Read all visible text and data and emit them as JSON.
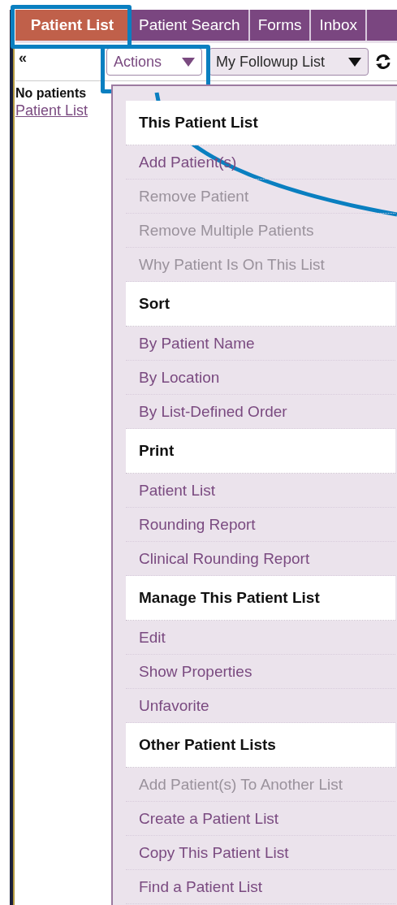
{
  "tabs": [
    {
      "label": "Patient List",
      "selected": true
    },
    {
      "label": "Patient Search",
      "selected": false
    },
    {
      "label": "Forms",
      "selected": false
    },
    {
      "label": "Inbox",
      "selected": false
    }
  ],
  "toolbar": {
    "collapse": "«",
    "actions": "Actions",
    "list_select": "My Followup List"
  },
  "sidebar": {
    "message": "No patients",
    "link": "Patient List"
  },
  "menu": {
    "sections": [
      {
        "title": "This Patient List",
        "items": [
          {
            "label": "Add Patient(s)",
            "disabled": false
          },
          {
            "label": "Remove Patient",
            "disabled": true
          },
          {
            "label": "Remove Multiple Patients",
            "disabled": true
          },
          {
            "label": "Why Patient Is On This List",
            "disabled": true
          }
        ]
      },
      {
        "title": "Sort",
        "items": [
          {
            "label": "By Patient Name",
            "disabled": false
          },
          {
            "label": "By Location",
            "disabled": false
          },
          {
            "label": "By List-Defined Order",
            "disabled": false
          }
        ]
      },
      {
        "title": "Print",
        "items": [
          {
            "label": "Patient List",
            "disabled": false
          },
          {
            "label": "Rounding Report",
            "disabled": false
          },
          {
            "label": "Clinical Rounding Report",
            "disabled": false
          }
        ]
      },
      {
        "title": "Manage This Patient List",
        "items": [
          {
            "label": "Edit",
            "disabled": false
          },
          {
            "label": "Show Properties",
            "disabled": false
          },
          {
            "label": "Unfavorite",
            "disabled": false
          }
        ]
      },
      {
        "title": "Other Patient Lists",
        "items": [
          {
            "label": "Add Patient(s) To Another List",
            "disabled": true
          },
          {
            "label": "Create a Patient List",
            "disabled": false
          },
          {
            "label": "Copy This Patient List",
            "disabled": false
          },
          {
            "label": "Find a Patient List",
            "disabled": false
          }
        ]
      }
    ]
  },
  "annotation": {
    "tab_box": true,
    "actions_box": true,
    "pointer_line": true
  }
}
